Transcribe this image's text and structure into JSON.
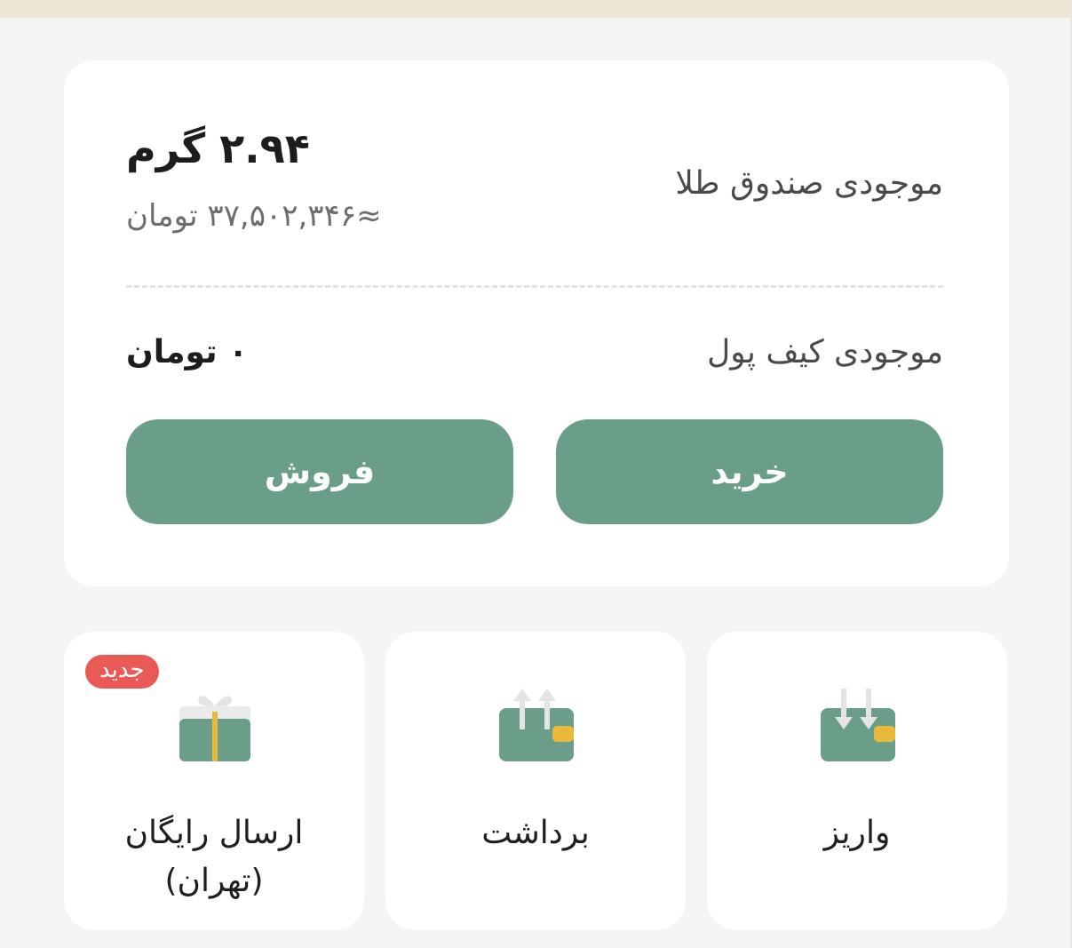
{
  "balance_card": {
    "gold_label": "موجودی صندوق طلا",
    "gold_grams": "۲.۹۴ گرم",
    "gold_toman": "≈۳۷,۵۰۲,۳۴۶ تومان",
    "wallet_label": "موجودی کیف پول",
    "wallet_value": "۰ تومان"
  },
  "actions": {
    "sell_label": "فروش",
    "buy_label": "خرید"
  },
  "tiles": {
    "gift": {
      "label_line1": "ارسال رایگان",
      "label_line2": "(تهران)",
      "badge": "جدید",
      "icon": "gift-box-icon"
    },
    "withdraw": {
      "label": "برداشت",
      "icon": "wallet-withdraw-icon"
    },
    "deposit": {
      "label": "واریز",
      "icon": "wallet-deposit-icon"
    }
  },
  "colors": {
    "accent_green": "#6b9e89",
    "gold_yellow": "#e8b93a",
    "badge_red": "#e95a57",
    "page_background": "#f5f5f5"
  }
}
